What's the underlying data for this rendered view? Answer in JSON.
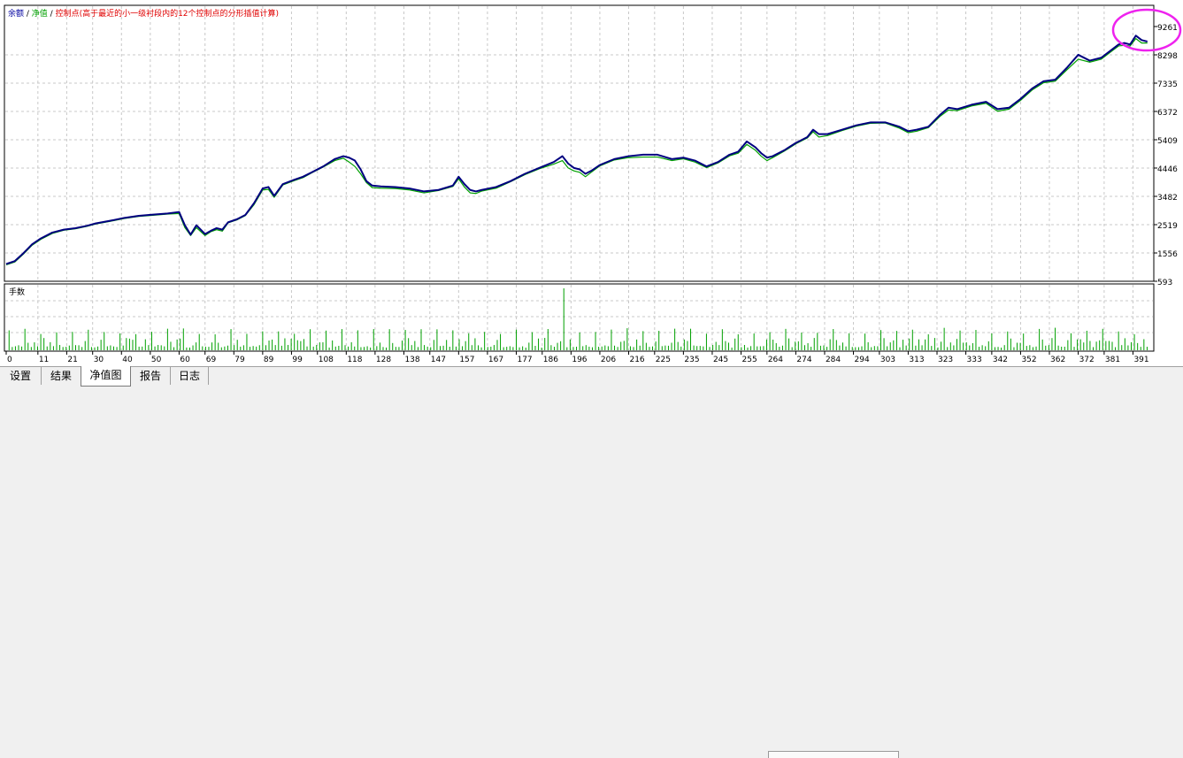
{
  "header": {
    "parts": [
      {
        "text": "余额",
        "color": "#0000a0"
      },
      {
        "text": " / ",
        "color": "#000000"
      },
      {
        "text": "净值",
        "color": "#00a000"
      },
      {
        "text": " / ",
        "color": "#000000"
      },
      {
        "text": "控制点(高于最近的小一级衬段内的12个控制点的分形插值计算)",
        "color": "#e00000"
      }
    ]
  },
  "subpanel": {
    "label": "手数"
  },
  "colors": {
    "balance": "#000080",
    "equity": "#00a000",
    "volume": "#00a000",
    "grid": "#c8c8c8",
    "highlight": "#ee22ee"
  },
  "tabs": [
    {
      "label": "设置",
      "active": false
    },
    {
      "label": "结果",
      "active": false
    },
    {
      "label": "净值图",
      "active": true
    },
    {
      "label": "报告",
      "active": false
    },
    {
      "label": "日志",
      "active": false
    }
  ],
  "chart_data": {
    "type": "line",
    "y_ticks": [
      "9261",
      "8298",
      "7335",
      "6372",
      "5409",
      "4446",
      "3482",
      "2519",
      "1556",
      "593"
    ],
    "x_ticks": [
      "0",
      "11",
      "21",
      "30",
      "40",
      "50",
      "60",
      "69",
      "79",
      "89",
      "99",
      "108",
      "118",
      "128",
      "138",
      "147",
      "157",
      "167",
      "177",
      "186",
      "196",
      "206",
      "216",
      "225",
      "235",
      "245",
      "255",
      "264",
      "274",
      "284",
      "294",
      "303",
      "313",
      "323",
      "333",
      "342",
      "352",
      "362",
      "372",
      "381",
      "391"
    ],
    "ylim": [
      593,
      9261
    ],
    "xlim": [
      0,
      397
    ],
    "grid": true,
    "series": [
      {
        "name": "余额",
        "x": [
          0,
          3,
          6,
          9,
          12,
          16,
          20,
          24,
          28,
          31,
          36,
          41,
          46,
          51,
          56,
          60,
          62,
          64,
          66,
          69,
          71,
          73,
          75,
          77,
          80,
          83,
          86,
          89,
          91,
          93,
          96,
          100,
          103,
          106,
          110,
          114,
          117,
          119,
          121,
          123,
          125,
          127,
          130,
          135,
          140,
          145,
          150,
          155,
          157,
          159,
          161,
          163,
          165,
          170,
          175,
          180,
          185,
          190,
          193,
          195,
          197,
          199,
          201,
          203,
          206,
          211,
          216,
          221,
          226,
          231,
          235,
          239,
          243,
          247,
          251,
          254,
          257,
          260,
          262,
          264,
          266,
          270,
          274,
          278,
          280,
          282,
          285,
          290,
          295,
          300,
          305,
          310,
          313,
          316,
          320,
          324,
          327,
          330,
          335,
          340,
          344,
          348,
          352,
          356,
          360,
          364,
          368,
          372,
          376,
          380,
          384,
          386,
          388,
          390,
          392,
          394,
          396
        ],
        "values": [
          1180,
          1280,
          1550,
          1850,
          2050,
          2250,
          2350,
          2400,
          2480,
          2560,
          2650,
          2750,
          2820,
          2860,
          2900,
          2950,
          2500,
          2180,
          2500,
          2200,
          2310,
          2400,
          2350,
          2600,
          2700,
          2850,
          3250,
          3750,
          3800,
          3500,
          3900,
          4050,
          4150,
          4300,
          4500,
          4750,
          4850,
          4800,
          4700,
          4400,
          4000,
          3850,
          3820,
          3800,
          3750,
          3650,
          3700,
          3850,
          4150,
          3900,
          3700,
          3650,
          3700,
          3800,
          4000,
          4250,
          4450,
          4650,
          4850,
          4600,
          4450,
          4400,
          4250,
          4350,
          4550,
          4750,
          4850,
          4900,
          4900,
          4750,
          4800,
          4700,
          4500,
          4650,
          4900,
          5000,
          5350,
          5150,
          4950,
          4800,
          4850,
          5050,
          5300,
          5500,
          5750,
          5600,
          5600,
          5750,
          5900,
          6000,
          6000,
          5850,
          5700,
          5750,
          5850,
          6250,
          6500,
          6450,
          6600,
          6700,
          6450,
          6500,
          6800,
          7150,
          7400,
          7450,
          7850,
          8300,
          8100,
          8200,
          8500,
          8650,
          8700,
          8650,
          8950,
          8800,
          8750
        ]
      },
      {
        "name": "净值",
        "x": [
          0,
          3,
          6,
          9,
          12,
          16,
          20,
          24,
          28,
          31,
          36,
          41,
          46,
          51,
          56,
          60,
          62,
          64,
          66,
          69,
          71,
          73,
          75,
          77,
          80,
          83,
          86,
          89,
          91,
          93,
          96,
          100,
          103,
          106,
          110,
          114,
          117,
          119,
          121,
          123,
          125,
          127,
          130,
          135,
          140,
          145,
          150,
          155,
          157,
          159,
          161,
          163,
          165,
          170,
          175,
          180,
          185,
          190,
          193,
          195,
          197,
          199,
          201,
          203,
          206,
          211,
          216,
          221,
          226,
          231,
          235,
          239,
          243,
          247,
          251,
          254,
          257,
          260,
          262,
          264,
          266,
          270,
          274,
          278,
          280,
          282,
          285,
          290,
          295,
          300,
          305,
          310,
          313,
          316,
          320,
          324,
          327,
          330,
          335,
          340,
          344,
          348,
          352,
          356,
          360,
          364,
          368,
          372,
          376,
          380,
          384,
          386,
          388,
          390,
          392,
          394,
          396
        ],
        "values": [
          1150,
          1250,
          1520,
          1820,
          2020,
          2220,
          2330,
          2380,
          2460,
          2540,
          2630,
          2730,
          2800,
          2840,
          2880,
          2900,
          2420,
          2150,
          2420,
          2150,
          2280,
          2350,
          2300,
          2580,
          2680,
          2830,
          3200,
          3700,
          3720,
          3450,
          3870,
          4020,
          4120,
          4280,
          4480,
          4700,
          4780,
          4650,
          4500,
          4250,
          3950,
          3780,
          3760,
          3750,
          3700,
          3600,
          3680,
          3820,
          4080,
          3800,
          3600,
          3580,
          3660,
          3760,
          3980,
          4220,
          4420,
          4580,
          4700,
          4450,
          4350,
          4300,
          4150,
          4300,
          4520,
          4720,
          4800,
          4820,
          4820,
          4700,
          4760,
          4650,
          4460,
          4620,
          4860,
          4950,
          5250,
          5050,
          4850,
          4700,
          4800,
          5020,
          5270,
          5470,
          5680,
          5500,
          5550,
          5720,
          5870,
          5970,
          5980,
          5800,
          5650,
          5700,
          5820,
          6200,
          6420,
          6400,
          6560,
          6650,
          6380,
          6450,
          6750,
          7100,
          7350,
          7400,
          7780,
          8150,
          8050,
          8150,
          8450,
          8600,
          8620,
          8600,
          8850,
          8700,
          8700
        ]
      }
    ]
  }
}
